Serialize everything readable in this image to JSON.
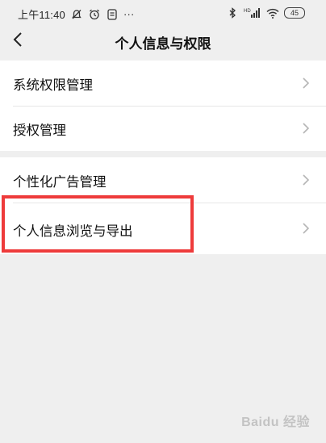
{
  "status_bar": {
    "time": "上午11:40",
    "more": "···",
    "network": "HD",
    "battery": "45",
    "icons": [
      "notification-off-icon",
      "alarm-icon",
      "app-notification-icon",
      "bluetooth-icon",
      "signal-icon",
      "wifi-icon",
      "battery-icon"
    ]
  },
  "header": {
    "title": "个人信息与权限",
    "back_icon": "chevron-left-icon"
  },
  "groups": [
    {
      "items": [
        {
          "label": "系统权限管理"
        },
        {
          "label": "授权管理"
        }
      ]
    },
    {
      "items": [
        {
          "label": "个性化广告管理"
        },
        {
          "label": "个人信息浏览与导出"
        }
      ]
    }
  ],
  "colors": {
    "background": "#efefef",
    "card": "#ffffff",
    "highlight": "#ee3b3b"
  },
  "watermark": "Baidu 经验"
}
